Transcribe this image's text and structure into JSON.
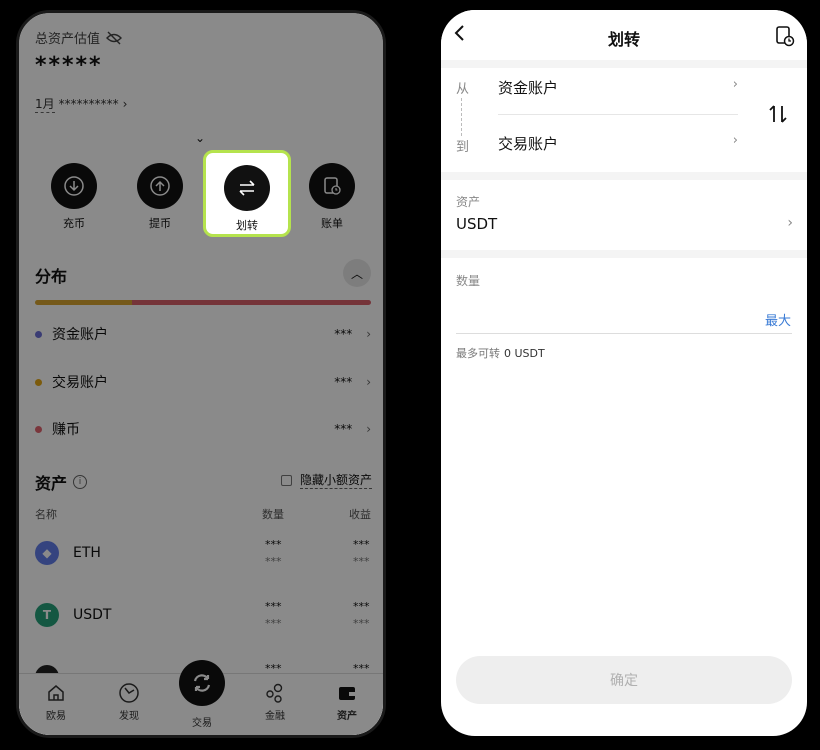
{
  "left": {
    "valuation_label": "总资产估值",
    "balance_masked": "*****",
    "period_label": "1月",
    "period_value": "**********",
    "actions": [
      {
        "label": "充币",
        "icon": "deposit-icon"
      },
      {
        "label": "提币",
        "icon": "withdraw-icon"
      },
      {
        "label": "划转",
        "icon": "transfer-icon"
      },
      {
        "label": "账单",
        "icon": "bill-icon"
      }
    ],
    "distribution": {
      "title": "分布",
      "bar_fractions": [
        0.29,
        0.71
      ],
      "bar_colors": [
        "#d9a531",
        "#d9606a"
      ],
      "rows": [
        {
          "name": "资金账户",
          "value": "***",
          "color": "#6b6fd6"
        },
        {
          "name": "交易账户",
          "value": "***",
          "color": "#e6a817"
        },
        {
          "name": "赚币",
          "value": "***",
          "color": "#e26470"
        }
      ]
    },
    "assets": {
      "title": "资产",
      "hide_small_label": "隐藏小额资产",
      "col_name": "名称",
      "col_amount": "数量",
      "col_pnl": "收益",
      "rows": [
        {
          "symbol": "ETH",
          "amount": "***",
          "amount_sub": "***",
          "pnl": "***",
          "pnl_sub": "***",
          "color": "#627eea"
        },
        {
          "symbol": "USDT",
          "amount": "***",
          "amount_sub": "***",
          "pnl": "***",
          "pnl_sub": "***",
          "color": "#26a17b"
        },
        {
          "symbol": "",
          "amount": "***",
          "amount_sub": "",
          "pnl": "***",
          "pnl_sub": "",
          "color": "#222222"
        }
      ]
    },
    "nav": [
      {
        "label": "欧易",
        "icon": "home-icon"
      },
      {
        "label": "发现",
        "icon": "discover-icon"
      },
      {
        "label": "交易",
        "icon": "trade-icon"
      },
      {
        "label": "金融",
        "icon": "finance-icon"
      },
      {
        "label": "资产",
        "icon": "wallet-icon"
      }
    ]
  },
  "right": {
    "title": "划转",
    "from_label": "从",
    "to_label": "到",
    "from_account": "资金账户",
    "to_account": "交易账户",
    "asset_label": "资产",
    "asset_value": "USDT",
    "amount_label": "数量",
    "amount_value": "",
    "max_label": "最大",
    "available_label": "最多可转",
    "available_value": "0 USDT",
    "confirm_label": "确定"
  }
}
